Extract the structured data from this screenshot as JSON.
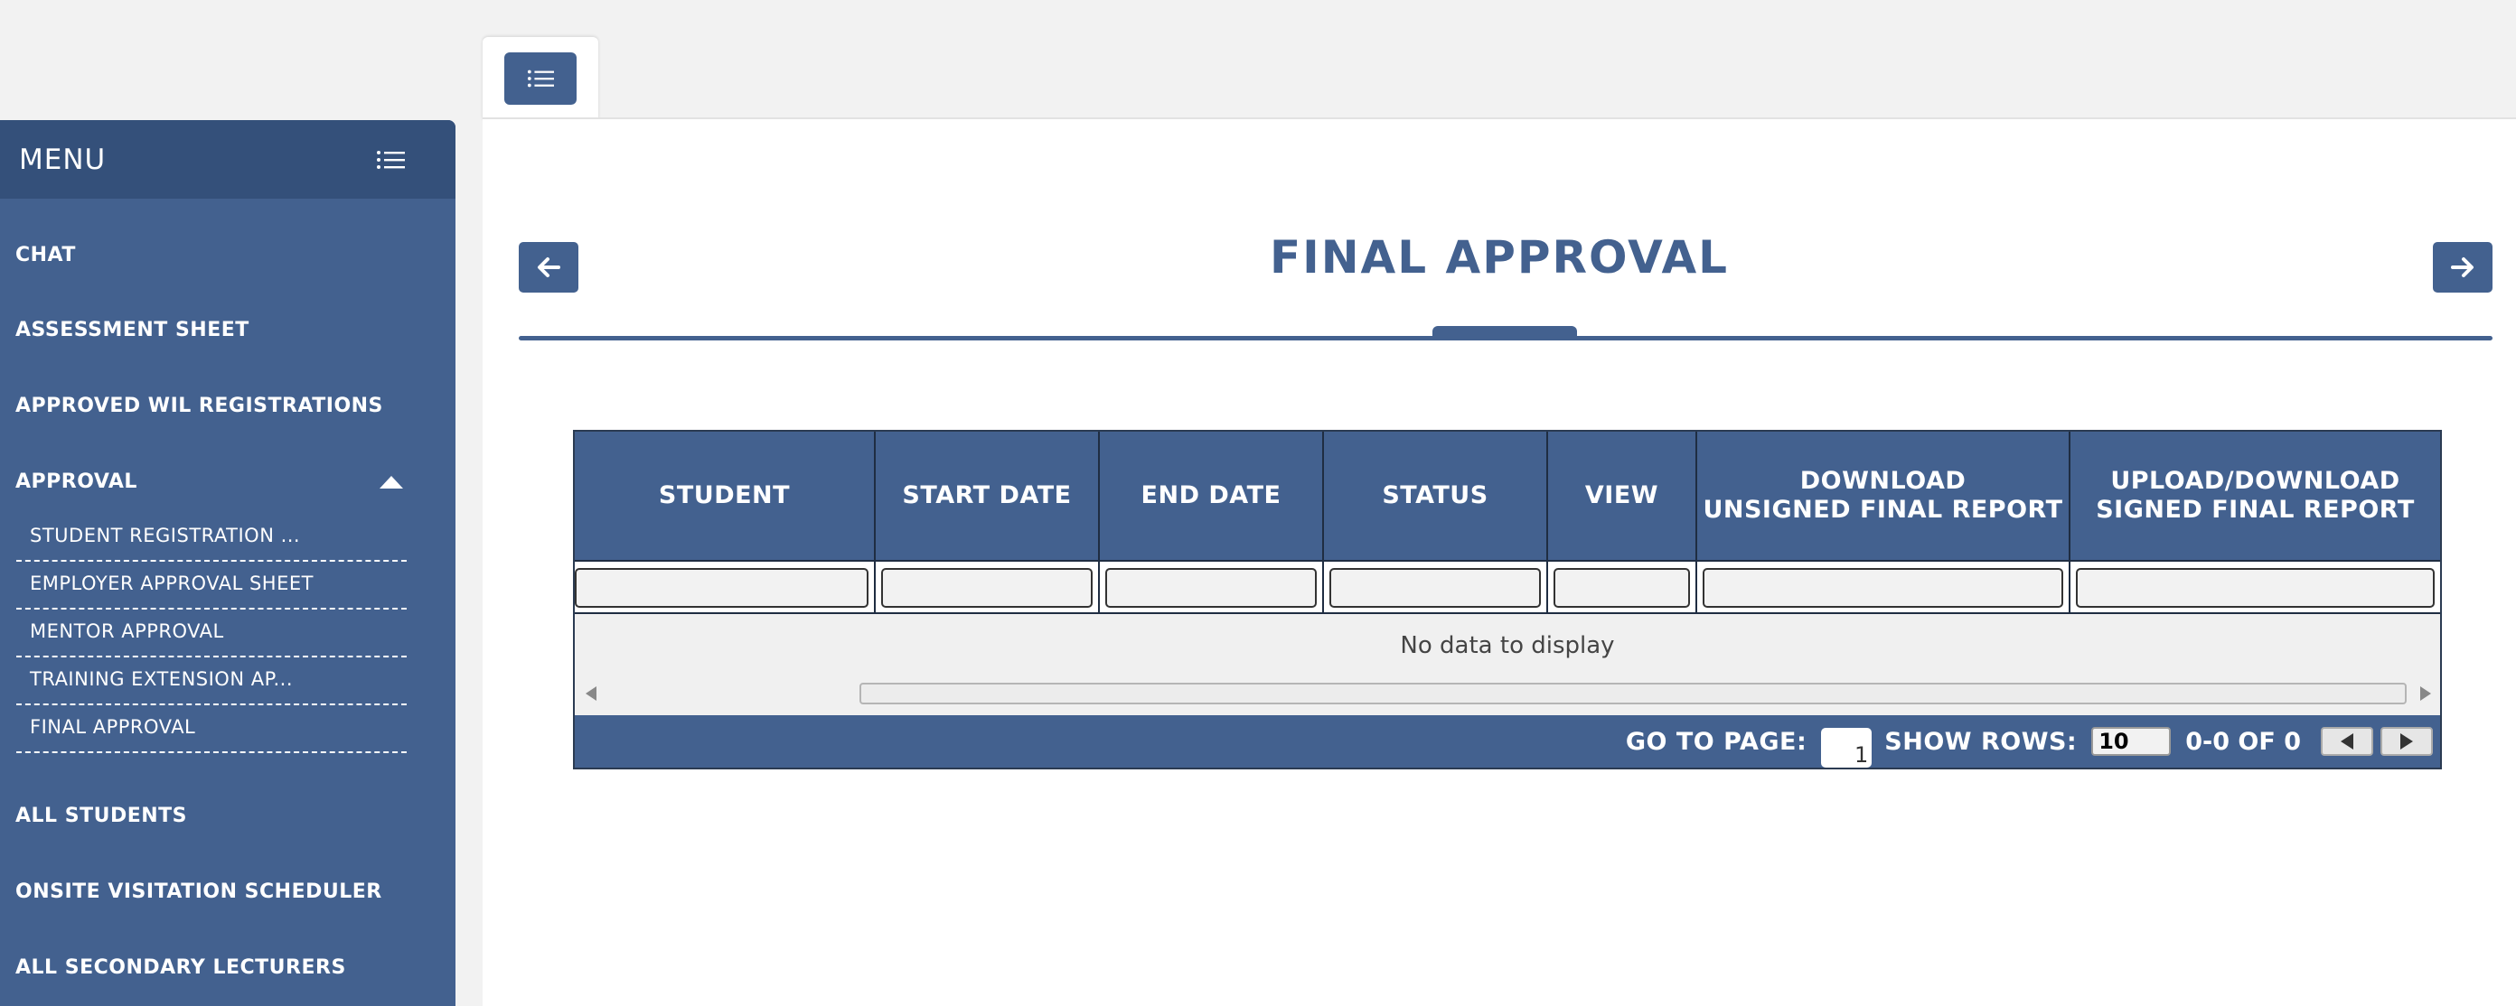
{
  "sidebar": {
    "title": "MENU",
    "icon": "list-icon",
    "items": [
      {
        "label": "CHAT"
      },
      {
        "label": "ASSESSMENT SHEET"
      },
      {
        "label": "APPROVED WIL REGISTRATIONS"
      },
      {
        "label": "APPROVAL",
        "expanded": true
      },
      {
        "label": "ALL STUDENTS"
      },
      {
        "label": "ONSITE VISITATION SCHEDULER"
      },
      {
        "label": "ALL SECONDARY LECTURERS"
      }
    ],
    "approval_subitems": [
      {
        "label": "STUDENT REGISTRATION ..."
      },
      {
        "label": "EMPLOYER APPROVAL SHEET"
      },
      {
        "label": "MENTOR APPROVAL"
      },
      {
        "label": "TRAINING EXTENSION AP..."
      },
      {
        "label": "FINAL APPROVAL"
      }
    ]
  },
  "page": {
    "title": "FINAL APPROVAL",
    "back_icon": "arrow-left-icon",
    "forward_icon": "arrow-right-icon",
    "tab_icon": "list-icon"
  },
  "grid": {
    "columns": [
      {
        "label": "STUDENT"
      },
      {
        "label": "START DATE"
      },
      {
        "label": "END DATE"
      },
      {
        "label": "STATUS"
      },
      {
        "label": "VIEW"
      },
      {
        "label_line1": "DOWNLOAD",
        "label_line2": "UNSIGNED FINAL REPORT"
      },
      {
        "label_line1": "UPLOAD/DOWNLOAD",
        "label_line2": "SIGNED FINAL REPORT"
      }
    ],
    "empty_message": "No data to display",
    "pager": {
      "go_to_page_label": "GO TO PAGE:",
      "page_value": "1",
      "show_rows_label": "SHOW ROWS:",
      "rows_value": "10",
      "range_text": "0-0 OF 0"
    }
  },
  "colors": {
    "primary": "#43618f",
    "sidebar_header": "#34507a",
    "background": "#f2f2f2"
  }
}
